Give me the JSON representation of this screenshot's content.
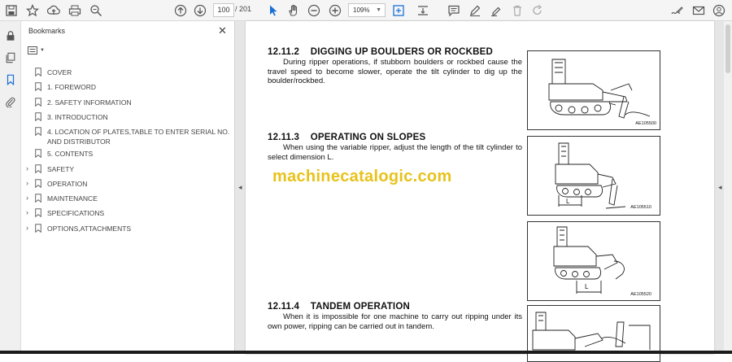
{
  "toolbar": {
    "page_current": "100",
    "page_total": "/ 201",
    "zoom": "109%"
  },
  "bookmarks_panel": {
    "title": "Bookmarks",
    "items": [
      {
        "label": "COVER",
        "expandable": false
      },
      {
        "label": "1. FOREWORD",
        "expandable": false
      },
      {
        "label": "2. SAFETY INFORMATION",
        "expandable": false
      },
      {
        "label": "3. INTRODUCTION",
        "expandable": false
      },
      {
        "label": "4. LOCATION OF PLATES,TABLE TO ENTER SERIAL NO. AND DISTRIBUTOR",
        "expandable": false
      },
      {
        "label": "5. CONTENTS",
        "expandable": false
      },
      {
        "label": "SAFETY",
        "expandable": true
      },
      {
        "label": "OPERATION",
        "expandable": true
      },
      {
        "label": "MAINTENANCE",
        "expandable": true
      },
      {
        "label": "SPECIFICATIONS",
        "expandable": true
      },
      {
        "label": "OPTIONS,ATTACHMENTS",
        "expandable": true
      }
    ]
  },
  "document": {
    "sections": [
      {
        "number": "12.11.2",
        "title": "DIGGING UP BOULDERS OR ROCKBED",
        "text": "During ripper operations, if stubborn boulders or rockbed cause the travel speed to become slower, operate the tilt cylinder to dig up the boulder/rockbed."
      },
      {
        "number": "12.11.3",
        "title": "OPERATING ON SLOPES",
        "text": "When using the variable ripper, adjust the length of the tilt cylinder to select dimension L."
      },
      {
        "number": "12.11.4",
        "title": "TANDEM OPERATION",
        "text": "When it is impossible for one machine to carry out ripping under its own power, ripping can be carried out in tandem."
      }
    ],
    "figures": [
      {
        "code": "AE105500"
      },
      {
        "code": "AE105510",
        "dimension_label": "L"
      },
      {
        "code": "AE105520",
        "dimension_label": "L"
      },
      {
        "code": ""
      }
    ],
    "watermark": "machinecatalogic.com"
  },
  "colors": {
    "watermark": "#e8c21a",
    "toolbar_bg": "#f5f5f5",
    "viewer_bg": "#e6e6e6"
  },
  "icons": {
    "toolbar": [
      "save-icon",
      "star-icon",
      "upload-icon",
      "print-icon",
      "zoom-search-icon",
      "page-up-icon",
      "page-down-icon",
      "select-cursor-icon",
      "hand-icon",
      "zoom-out-icon",
      "zoom-in-icon",
      "fit-page-icon",
      "scroll-mode-icon",
      "comment-icon",
      "pen-icon",
      "highlight-icon",
      "trash-icon",
      "redo-icon",
      "sign-icon",
      "mail-icon",
      "account-icon"
    ],
    "rail": [
      "lock-icon",
      "pages-icon",
      "bookmark-icon",
      "attachment-icon"
    ]
  }
}
